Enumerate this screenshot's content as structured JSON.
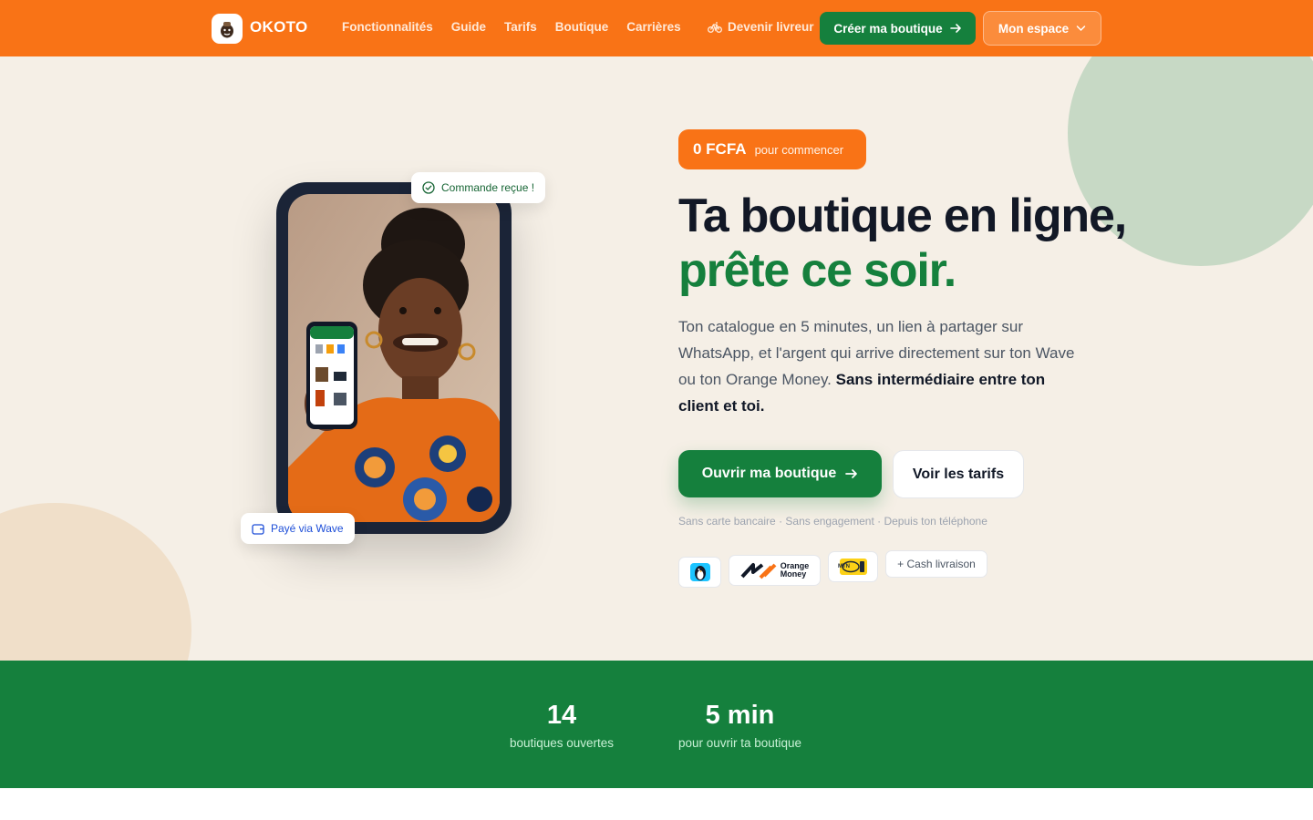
{
  "header": {
    "brand": "OKOTO",
    "nav": [
      "Fonctionnalités",
      "Guide",
      "Tarifs",
      "Boutique",
      "Carrières"
    ],
    "courier_label": "Devenir livreur",
    "create_label": "Créer ma boutique",
    "space_label": "Mon espace"
  },
  "hero": {
    "price_value": "0 FCFA",
    "price_suffix": "pour commencer",
    "title_line1": "Ta boutique en ligne,",
    "title_line2": "prête ce soir.",
    "lead_plain": "Ton catalogue en 5 minutes, un lien à partager sur WhatsApp, et l'argent qui arrive directement sur ton Wave ou ton Orange Money. ",
    "lead_bold": "Sans intermédiaire entre ton client et toi.",
    "cta_primary": "Ouvrir ma boutique",
    "cta_secondary": "Voir les tarifs",
    "fine_print": "Sans carte bancaire · Sans engagement · Depuis ton téléphone",
    "toast_order": "Commande reçue !",
    "toast_wave": "Payé via Wave",
    "orange_money_word1": "Orange",
    "orange_money_word2": "Money",
    "mtn_word": "MTN",
    "cash_option": "+ Cash livraison"
  },
  "stats": [
    {
      "value": "14",
      "label": "boutiques ouvertes"
    },
    {
      "value": "5 min",
      "label": "pour ouvrir ta boutique"
    }
  ],
  "colors": {
    "brand_orange": "#f97316",
    "brand_green": "#15803d",
    "hero_bg": "#f5efe6"
  },
  "icons": [
    "store-logo-icon",
    "bicycle-icon",
    "arrow-right-icon",
    "chevron-down-icon",
    "check-circle-icon",
    "wallet-icon",
    "wave-penguin-icon",
    "orange-money-logo-icon",
    "mtn-logo-icon"
  ]
}
